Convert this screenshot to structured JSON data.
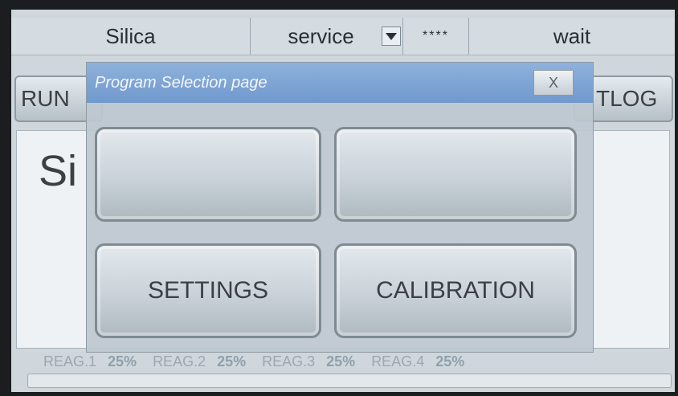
{
  "topbar": {
    "title": "Silica",
    "mode": "service",
    "password_mask": "****",
    "status": "wait"
  },
  "tabs": {
    "run": "RUN",
    "datalog": "TLOG"
  },
  "main": {
    "big_text": "Si"
  },
  "dialog": {
    "title": "Program Selection page",
    "close_label": "X",
    "buttons": [
      "",
      "",
      "SETTINGS",
      "CALIBRATION"
    ]
  },
  "reagents": [
    {
      "label": "REAG.1",
      "value": "25%"
    },
    {
      "label": "REAG.2",
      "value": "25%"
    },
    {
      "label": "REAG.3",
      "value": "25%"
    },
    {
      "label": "REAG.4",
      "value": "25%"
    }
  ],
  "progress": {
    "fraction": 0.0
  },
  "colors": {
    "header_blue": "#7aa2d4",
    "panel_bg": "#cfd7dc"
  },
  "icons": {
    "dropdown": "chevron-down-icon"
  }
}
